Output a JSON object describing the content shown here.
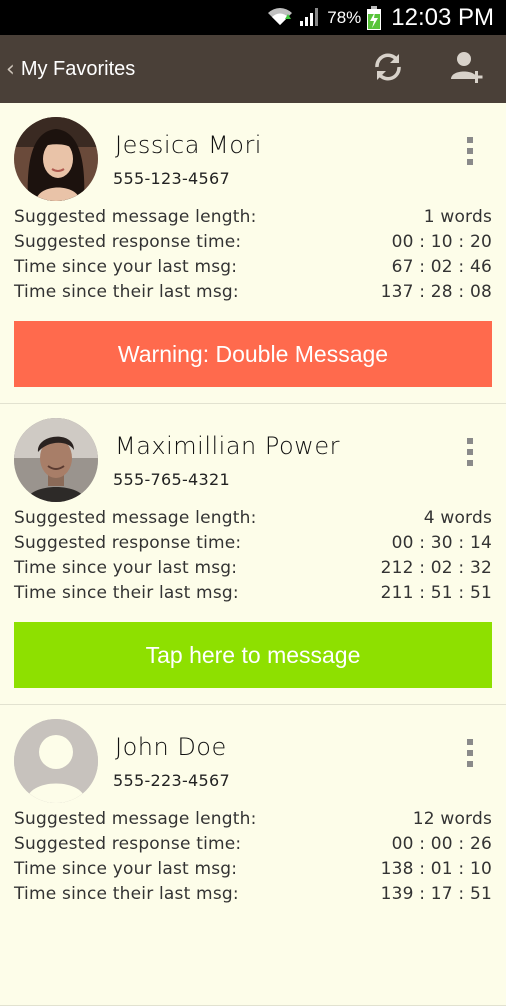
{
  "status_bar": {
    "battery": "78%",
    "clock": "12:03 PM",
    "icons": [
      "wifi-icon",
      "signal-icon",
      "battery-charging-icon"
    ]
  },
  "action_bar": {
    "back_icon": "chevron-left-icon",
    "title": "My Favorites",
    "actions": [
      "refresh-icon",
      "add-user-icon"
    ]
  },
  "colors": {
    "background": "#fdfde9",
    "action_bar": "#4a4038",
    "warning": "#ff6a4d",
    "go": "#8ee000"
  },
  "stat_labels": {
    "length": "Suggested message length:",
    "response": "Suggested response time:",
    "your_last": "Time since your last msg:",
    "their_last": "Time since their last msg:"
  },
  "contacts": [
    {
      "name": "Jessica Mori",
      "phone": "555-123-4567",
      "length": "1 words",
      "response": "00 : 10 : 20",
      "your_last": "67 : 02 : 46",
      "their_last": "137 : 28 : 08",
      "action": "Warning: Double Message",
      "action_color": "#ff6a4d"
    },
    {
      "name": "Maximillian Power",
      "phone": "555-765-4321",
      "length": "4 words",
      "response": "00 : 30 : 14",
      "your_last": "212 : 02 : 32",
      "their_last": "211 : 51 : 51",
      "action": "Tap here to message",
      "action_color": "#8ee000"
    },
    {
      "name": "John Doe",
      "phone": "555-223-4567",
      "length": "12 words",
      "response": "00 : 00 : 26",
      "your_last": "138 : 01 : 10",
      "their_last": "139 : 17 : 51"
    }
  ]
}
